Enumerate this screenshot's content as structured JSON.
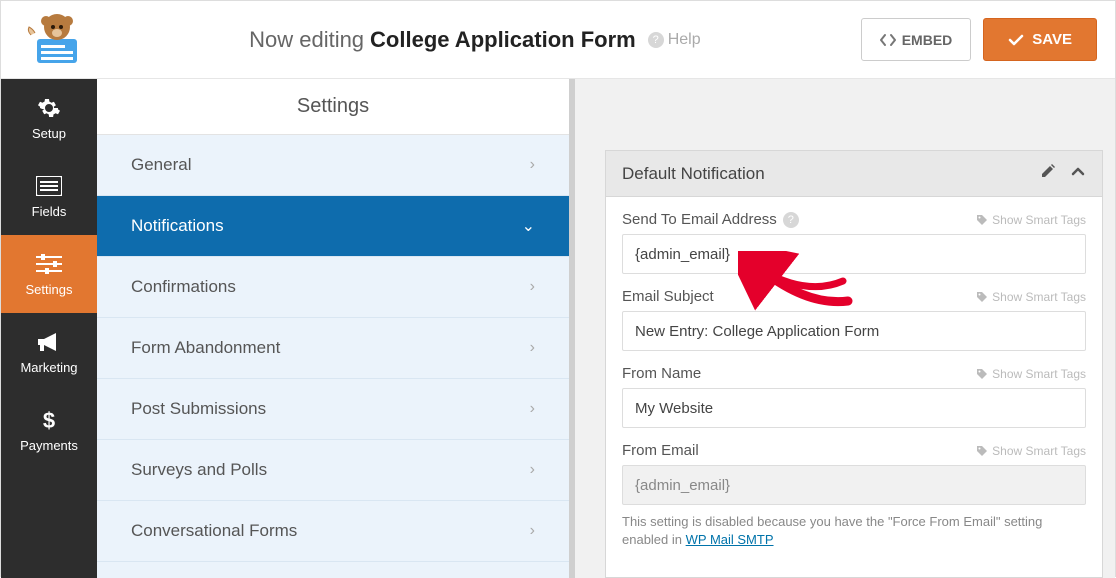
{
  "topbar": {
    "now_editing": "Now editing",
    "form_name": "College Application Form",
    "help_label": "Help",
    "embed_label": "EMBED",
    "save_label": "SAVE"
  },
  "nav": {
    "items": [
      {
        "key": "setup",
        "label": "Setup"
      },
      {
        "key": "fields",
        "label": "Fields"
      },
      {
        "key": "settings",
        "label": "Settings"
      },
      {
        "key": "marketing",
        "label": "Marketing"
      },
      {
        "key": "payments",
        "label": "Payments"
      }
    ],
    "active": "settings"
  },
  "side": {
    "title": "Settings",
    "items": [
      {
        "key": "general",
        "label": "General"
      },
      {
        "key": "notifications",
        "label": "Notifications",
        "active": true
      },
      {
        "key": "confirmations",
        "label": "Confirmations"
      },
      {
        "key": "abandonment",
        "label": "Form Abandonment"
      },
      {
        "key": "post-submissions",
        "label": "Post Submissions"
      },
      {
        "key": "surveys",
        "label": "Surveys and Polls"
      },
      {
        "key": "conversational",
        "label": "Conversational Forms"
      }
    ]
  },
  "notification": {
    "title": "Default Notification",
    "show_smart_tags": "Show Smart Tags",
    "fields": {
      "send_to": {
        "label": "Send To Email Address",
        "value": "{admin_email}"
      },
      "subject": {
        "label": "Email Subject",
        "value": "New Entry: College Application Form"
      },
      "from_name": {
        "label": "From Name",
        "value": "My Website"
      },
      "from_email": {
        "label": "From Email",
        "value": "{admin_email}",
        "disabled": true
      }
    },
    "from_email_note_prefix": "This setting is disabled because you have the \"Force From Email\" setting enabled in ",
    "from_email_note_link": "WP Mail SMTP"
  }
}
